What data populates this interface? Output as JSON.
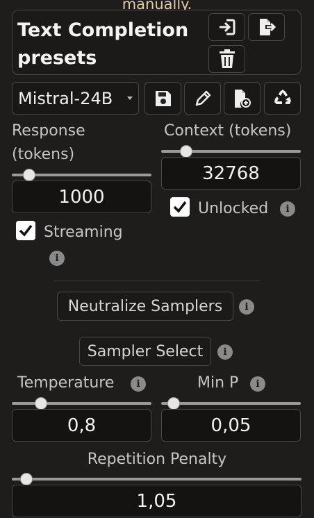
{
  "top_note": "manually.",
  "presets": {
    "title": "Text Completion presets",
    "icons": [
      "import-icon",
      "export-icon",
      "delete-icon"
    ],
    "selected": "Mistral-24B",
    "action_icons": [
      "save-icon",
      "rename-icon",
      "new-file-icon",
      "restore-icon"
    ]
  },
  "response": {
    "label": "Response (tokens)",
    "value": "1000",
    "slider_fraction": 0.03
  },
  "context": {
    "label": "Context (tokens)",
    "value": "32768",
    "slider_fraction": 0.15,
    "unlocked_label": "Unlocked",
    "unlocked_checked": true
  },
  "streaming": {
    "label": "Streaming",
    "checked": true
  },
  "neutralize_label": "Neutralize Samplers",
  "sampler_select_label": "Sampler Select",
  "temperature": {
    "label": "Temperature",
    "value": "0,8",
    "slider_fraction": 0.18
  },
  "min_p": {
    "label": "Min P",
    "value": "0,05",
    "slider_fraction": 0.05
  },
  "repetition_penalty": {
    "label": "Repetition Penalty",
    "value": "1,05",
    "slider_fraction": 0.03
  },
  "info_glyph": "i",
  "colors": {
    "background": "#1f1d1c",
    "note": "#e0c9a6",
    "thumb": "#e6e6e6"
  }
}
